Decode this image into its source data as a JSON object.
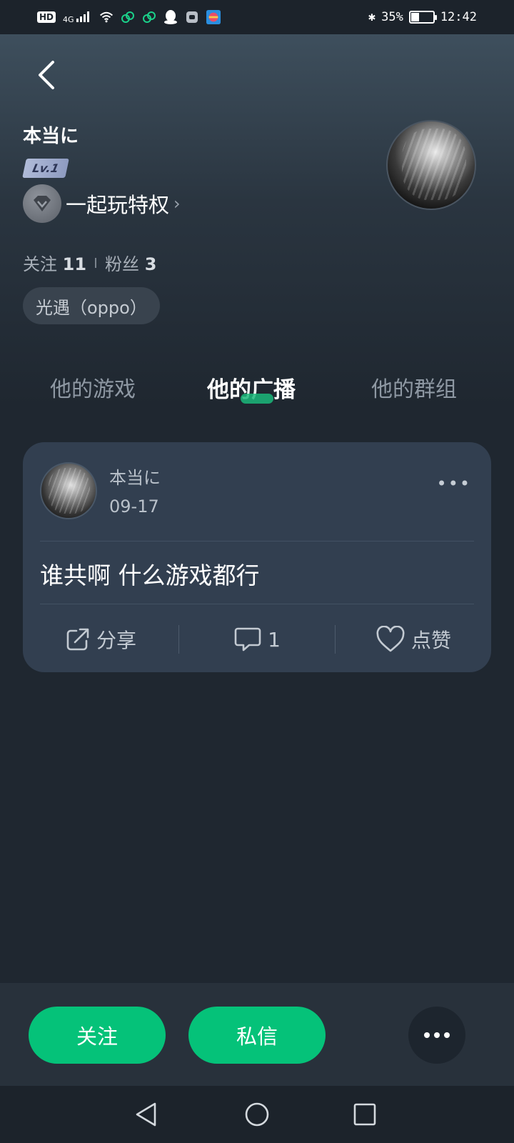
{
  "status_bar": {
    "hd": "HD",
    "signal": "4G",
    "bluetooth": "✱",
    "battery_percent": "35%",
    "time": "12:42",
    "battery_level": 0.35,
    "icons": [
      "hd-icon",
      "signal-icon",
      "wifi-icon",
      "link-icon",
      "link-icon",
      "qq-icon",
      "app-icon",
      "app-icon",
      "bluetooth-icon",
      "battery-icon"
    ]
  },
  "profile": {
    "nickname": "本当に",
    "level": "Lv.1",
    "privilege": "一起玩特权",
    "follow_label": "关注",
    "follow_count": "11",
    "fans_label": "粉丝",
    "fans_count": "3",
    "game_tag": "光遇（oppo）"
  },
  "tabs": [
    {
      "label": "他的游戏",
      "active": false
    },
    {
      "label": "他的广播",
      "active": true
    },
    {
      "label": "他的群组",
      "active": false
    }
  ],
  "post": {
    "author": "本当に",
    "date": "09-17",
    "more": "•••",
    "content": "谁共啊  什么游戏都行",
    "share_label": "分享",
    "comment_count": "1",
    "like_label": "点赞"
  },
  "actions": {
    "follow_button": "关注",
    "message_button": "私信"
  },
  "colors": {
    "accent": "#05c279",
    "background": "#1f2730",
    "card": "#323f50"
  }
}
